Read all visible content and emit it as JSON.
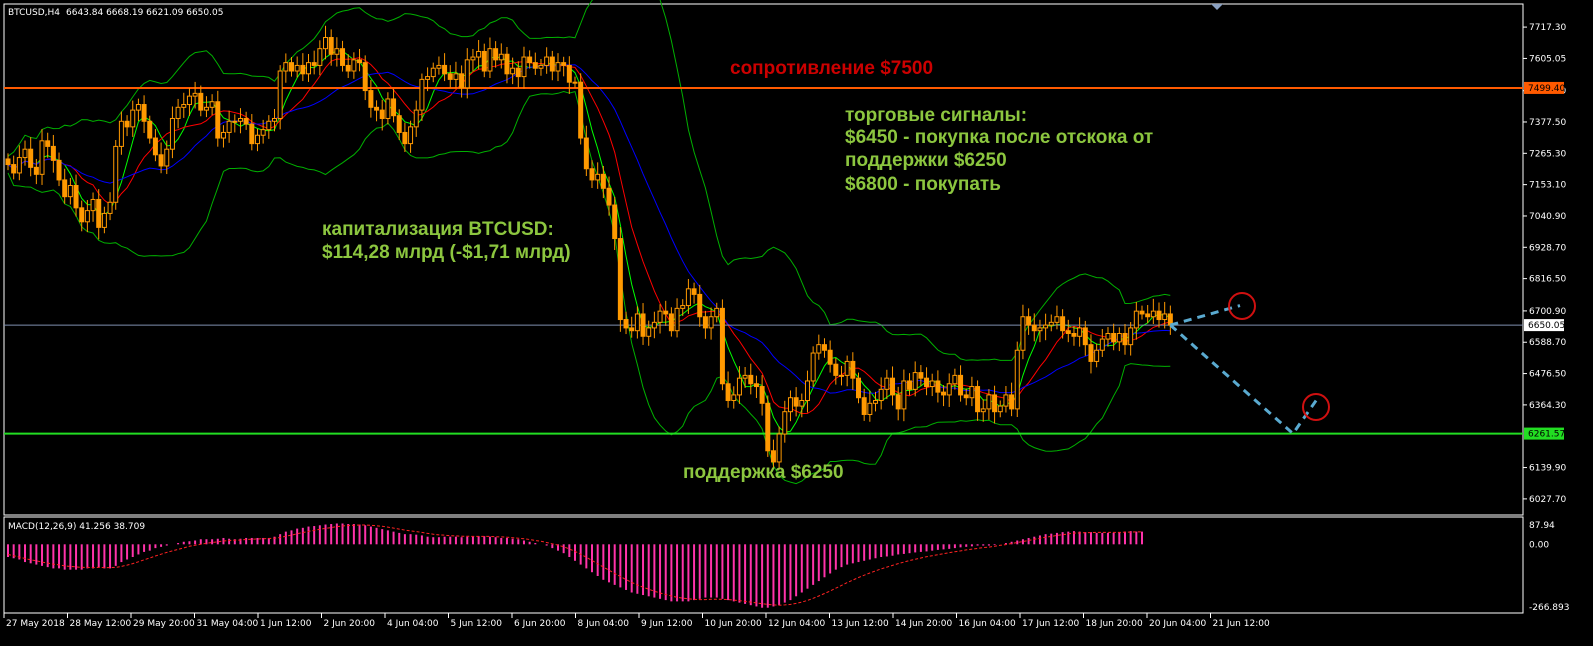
{
  "header": {
    "symbol_label": "BTCUSD,H4",
    "ohlc_label": "6643.84 6668.19 6621.09 6650.05",
    "macd_label": "MACD(12,26,9) 41.256 38.709"
  },
  "colors": {
    "background": "#000000",
    "bull_candle": "#ff9900",
    "bear_candle": "#ff9900",
    "bollinger": "#00b000",
    "ma_fast": "#00ff00",
    "ma_mid": "#ff0000",
    "ma_slow": "#0000ff",
    "resistance_line": "#ff5a00",
    "support_line": "#22dd22",
    "current_price_line": "#8090b0",
    "macd_hist": "#ff33aa",
    "macd_signal": "#ff2222",
    "forecast": "#5aaad0",
    "target_circle": "#d01010",
    "text_green": "#8cc63f",
    "text_red": "#cc0000"
  },
  "annotations": {
    "resistance": "сопротивление $7500",
    "signals_title": "торговые сигналы:",
    "signal_1": "$6450 - покупка после отскока от",
    "signal_1b": "поддержки $6250",
    "signal_2": "$6800 - покупать",
    "cap_title": "капитализация BTCUSD:",
    "cap_value": "$114,28 млрд (-$1,71 млрд)",
    "support": "поддержка $6250"
  },
  "chart_data": [
    {
      "type": "candlestick",
      "symbol": "BTCUSD",
      "timeframe": "H4",
      "ylim": [
        5970,
        7800
      ],
      "price_ticks": [
        "7717.30",
        "7605.05",
        "7489.40",
        "7377.50",
        "7265.30",
        "7153.10",
        "7040.90",
        "6928.70",
        "6816.50",
        "6700.90",
        "6588.70",
        "6476.50",
        "6364.30",
        "6139.90",
        "6027.70"
      ],
      "time_ticks": [
        "27 May 2018",
        "28 May 12:00",
        "29 May 20:00",
        "31 May 04:00",
        "1 Jun 12:00",
        "2 Jun 20:00",
        "4 Jun 04:00",
        "5 Jun 12:00",
        "6 Jun 20:00",
        "8 Jun 04:00",
        "9 Jun 12:00",
        "10 Jun 20:00",
        "12 Jun 04:00",
        "13 Jun 12:00",
        "14 Jun 20:00",
        "16 Jun 04:00",
        "17 Jun 12:00",
        "18 Jun 20:00",
        "20 Jun 04:00",
        "21 Jun 12:00"
      ],
      "levels": [
        {
          "name": "resistance",
          "value": 7499.4,
          "label": "7499.40"
        },
        {
          "name": "current",
          "value": 6650.05,
          "label": "6650.05"
        },
        {
          "name": "support",
          "value": 6261.57,
          "label": "6261.57"
        }
      ],
      "close": [
        7225,
        7195,
        7250,
        7280,
        7215,
        7190,
        7310,
        7290,
        7240,
        7170,
        7110,
        7150,
        7070,
        7020,
        7060,
        7100,
        7000,
        7050,
        7090,
        7290,
        7380,
        7360,
        7420,
        7440,
        7380,
        7320,
        7260,
        7220,
        7280,
        7390,
        7430,
        7440,
        7470,
        7480,
        7420,
        7430,
        7450,
        7320,
        7340,
        7380,
        7380,
        7390,
        7370,
        7300,
        7330,
        7350,
        7380,
        7390,
        7560,
        7590,
        7560,
        7580,
        7550,
        7590,
        7580,
        7640,
        7680,
        7620,
        7640,
        7580,
        7560,
        7600,
        7590,
        7490,
        7430,
        7420,
        7390,
        7460,
        7400,
        7340,
        7300,
        7360,
        7420,
        7530,
        7540,
        7570,
        7580,
        7550,
        7530,
        7550,
        7500,
        7600,
        7610,
        7630,
        7560,
        7640,
        7600,
        7620,
        7550,
        7570,
        7540,
        7610,
        7590,
        7570,
        7580,
        7610,
        7560,
        7590,
        7580,
        7520,
        7520,
        7320,
        7210,
        7170,
        7190,
        7140,
        7080,
        6960,
        6670,
        6640,
        6630,
        6690,
        6610,
        6640,
        6660,
        6700,
        6690,
        6630,
        6710,
        6720,
        6780,
        6760,
        6680,
        6640,
        6680,
        6710,
        6440,
        6380,
        6400,
        6460,
        6470,
        6440,
        6430,
        6370,
        6200,
        6160,
        6260,
        6340,
        6390,
        6360,
        6380,
        6450,
        6550,
        6580,
        6560,
        6510,
        6470,
        6470,
        6520,
        6460,
        6390,
        6330,
        6370,
        6380,
        6420,
        6460,
        6400,
        6350,
        6450,
        6420,
        6480,
        6460,
        6430,
        6450,
        6410,
        6400,
        6440,
        6470,
        6400,
        6390,
        6430,
        6340,
        6350,
        6400,
        6340,
        6360,
        6400,
        6350,
        6560,
        6680,
        6650,
        6630,
        6640,
        6650,
        6660,
        6680,
        6630,
        6620,
        6610,
        6640,
        6580,
        6520,
        6560,
        6600,
        6620,
        6590,
        6620,
        6580,
        6640,
        6700,
        6690,
        6680,
        6700,
        6670,
        6690,
        6650
      ]
    },
    {
      "type": "bar",
      "indicator": "MACD(12,26,9)",
      "ylim": [
        -266.893,
        87.94
      ],
      "ticks": [
        "87.94",
        "0.00",
        "-266.893"
      ],
      "histogram": [
        -50,
        -55,
        -60,
        -70,
        -75,
        -80,
        -85,
        -90,
        -95,
        -95,
        -100,
        -100,
        -100,
        -100,
        -95,
        -95,
        -90,
        -95,
        -95,
        -85,
        -70,
        -60,
        -50,
        -40,
        -30,
        -25,
        -15,
        -10,
        -5,
        0,
        5,
        10,
        12,
        15,
        20,
        20,
        20,
        22,
        25,
        22,
        20,
        22,
        25,
        25,
        25,
        25,
        25,
        30,
        40,
        50,
        55,
        62,
        65,
        70,
        72,
        75,
        78,
        80,
        82,
        82,
        80,
        80,
        78,
        75,
        70,
        65,
        60,
        55,
        50,
        45,
        40,
        40,
        38,
        35,
        30,
        28,
        28,
        30,
        30,
        30,
        28,
        30,
        30,
        32,
        32,
        30,
        28,
        25,
        25,
        22,
        20,
        15,
        10,
        5,
        0,
        -5,
        -15,
        -25,
        -35,
        -50,
        -65,
        -80,
        -95,
        -110,
        -125,
        -140,
        -150,
        -160,
        -170,
        -180,
        -190,
        -195,
        -200,
        -205,
        -210,
        -215,
        -220,
        -225,
        -225,
        -225,
        -225,
        -220,
        -215,
        -210,
        -210,
        -210,
        -215,
        -220,
        -225,
        -230,
        -235,
        -240,
        -245,
        -250,
        -250,
        -245,
        -240,
        -230,
        -220,
        -205,
        -190,
        -175,
        -160,
        -145,
        -130,
        -115,
        -100,
        -90,
        -80,
        -75,
        -70,
        -65,
        -60,
        -55,
        -50,
        -48,
        -45,
        -40,
        -38,
        -35,
        -32,
        -30,
        -28,
        -25,
        -22,
        -20,
        -18,
        -15,
        -12,
        -10,
        -8,
        -5,
        -5,
        -5,
        -3,
        0,
        5,
        10,
        15,
        20,
        25,
        30,
        35,
        40,
        42,
        45,
        48,
        50,
        52,
        50,
        48,
        48,
        45,
        45,
        45,
        45,
        48,
        50,
        52,
        50,
        50
      ],
      "signal": [
        -40,
        -45,
        -50,
        -56,
        -61,
        -65,
        -70,
        -74,
        -78,
        -81,
        -85,
        -87,
        -89,
        -91,
        -91,
        -92,
        -91,
        -92,
        -92,
        -91,
        -87,
        -82,
        -76,
        -69,
        -61,
        -54,
        -46,
        -39,
        -32,
        -26,
        -20,
        -14,
        -8,
        -4,
        0,
        4,
        7,
        10,
        13,
        15,
        16,
        17,
        19,
        20,
        21,
        22,
        23,
        24,
        27,
        32,
        36,
        42,
        46,
        51,
        55,
        59,
        63,
        66,
        70,
        72,
        74,
        75,
        76,
        76,
        75,
        73,
        71,
        68,
        64,
        60,
        56,
        53,
        50,
        47,
        43,
        40,
        37,
        36,
        34,
        33,
        32,
        32,
        31,
        31,
        31,
        31,
        30,
        29,
        28,
        26,
        24,
        22,
        19,
        15,
        12,
        7,
        2,
        -3,
        -10,
        -18,
        -28,
        -39,
        -51,
        -64,
        -77,
        -90,
        -102,
        -115,
        -127,
        -139,
        -150,
        -160,
        -169,
        -177,
        -185,
        -192,
        -198,
        -204,
        -209,
        -212,
        -215,
        -217,
        -218,
        -218,
        -217,
        -217,
        -217,
        -218,
        -220,
        -222,
        -225,
        -228,
        -231,
        -234,
        -237,
        -239,
        -240,
        -239,
        -237,
        -233,
        -228,
        -221,
        -213,
        -204,
        -194,
        -184,
        -173,
        -162,
        -151,
        -141,
        -131,
        -122,
        -113,
        -105,
        -97,
        -90,
        -83,
        -76,
        -70,
        -64,
        -59,
        -54,
        -49,
        -45,
        -41,
        -37,
        -33,
        -29,
        -26,
        -22,
        -19,
        -16,
        -13,
        -11,
        -8,
        -4,
        -1,
        3,
        7,
        11,
        15,
        20,
        24,
        28,
        31,
        35,
        38,
        41,
        44,
        45,
        46,
        46,
        47,
        47,
        47,
        47,
        47,
        48,
        48,
        49,
        49
      ]
    }
  ]
}
